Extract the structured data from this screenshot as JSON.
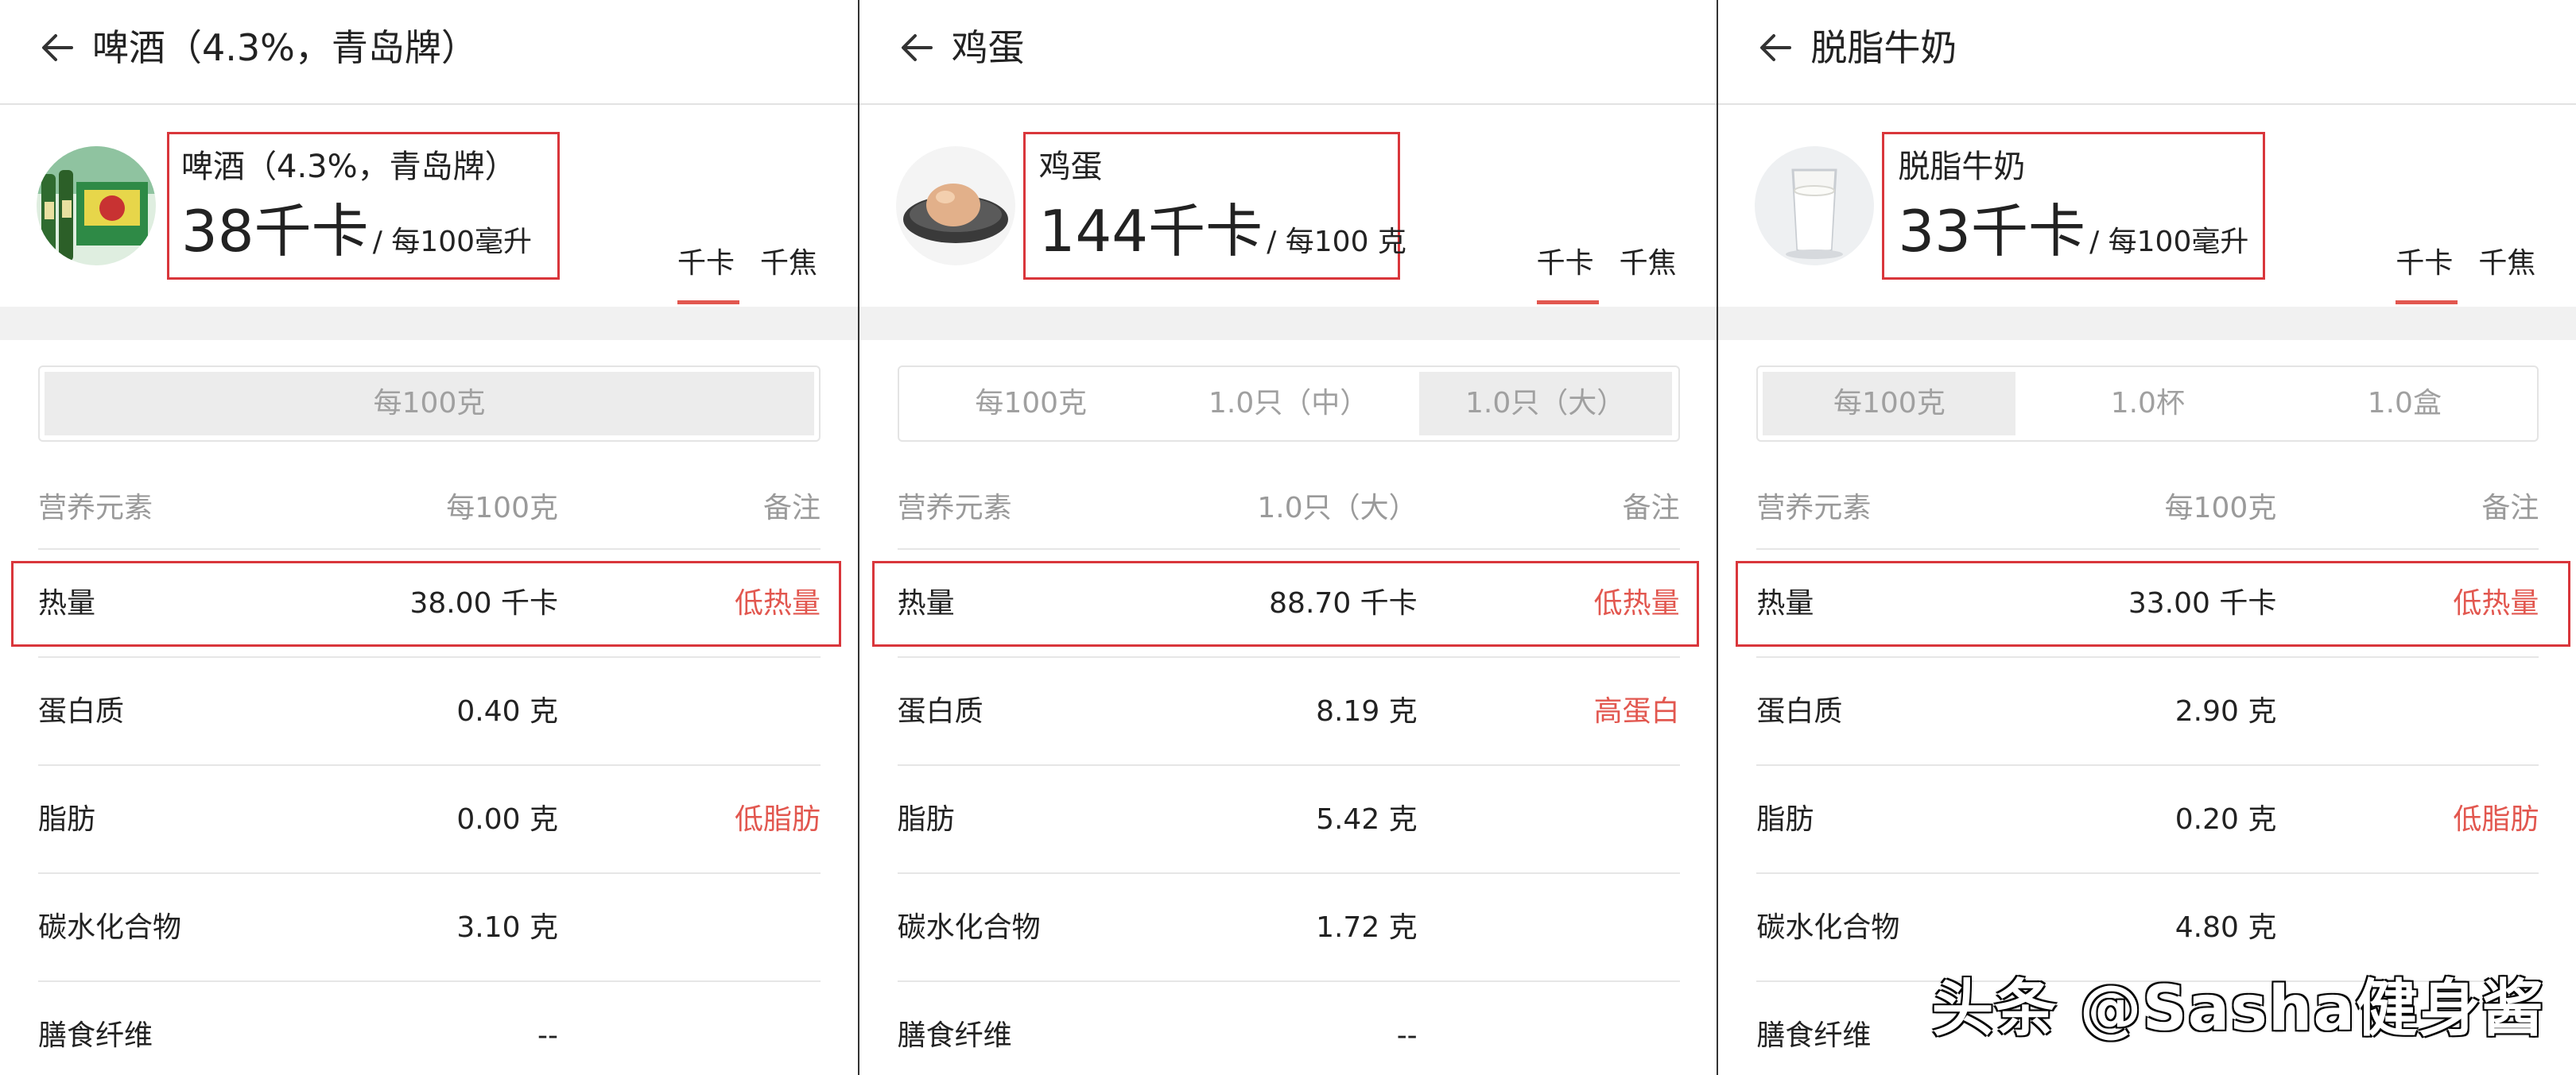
{
  "panels": [
    {
      "topbar_title": "啤酒（4.3%，青岛牌）",
      "food_name": "啤酒（4.3%，青岛牌）",
      "calories": "38千卡",
      "per_unit": "/ 每100毫升",
      "unit_tabs": [
        "千卡",
        "千焦"
      ],
      "servings": [
        "每100克"
      ],
      "selected_serving": 0,
      "table_header": {
        "name": "营养元素",
        "value": "每100克",
        "note": "备注"
      },
      "rows": [
        {
          "name": "热量",
          "value": "38.00 千卡",
          "note": "低热量"
        },
        {
          "name": "蛋白质",
          "value": "0.40 克",
          "note": ""
        },
        {
          "name": "脂肪",
          "value": "0.00 克",
          "note": "低脂肪"
        },
        {
          "name": "碳水化合物",
          "value": "3.10 克",
          "note": ""
        },
        {
          "name": "膳食纤维",
          "value": "--",
          "note": ""
        }
      ]
    },
    {
      "topbar_title": "鸡蛋",
      "food_name": "鸡蛋",
      "calories": "144千卡",
      "per_unit": "/ 每100 克",
      "unit_tabs": [
        "千卡",
        "千焦"
      ],
      "servings": [
        "每100克",
        "1.0只（中）",
        "1.0只（大）"
      ],
      "selected_serving": 2,
      "table_header": {
        "name": "营养元素",
        "value": "1.0只（大）",
        "note": "备注"
      },
      "rows": [
        {
          "name": "热量",
          "value": "88.70 千卡",
          "note": "低热量"
        },
        {
          "name": "蛋白质",
          "value": "8.19 克",
          "note": "高蛋白"
        },
        {
          "name": "脂肪",
          "value": "5.42 克",
          "note": ""
        },
        {
          "name": "碳水化合物",
          "value": "1.72 克",
          "note": ""
        },
        {
          "name": "膳食纤维",
          "value": "--",
          "note": ""
        }
      ]
    },
    {
      "topbar_title": "脱脂牛奶",
      "food_name": "脱脂牛奶",
      "calories": "33千卡",
      "per_unit": "/ 每100毫升",
      "unit_tabs": [
        "千卡",
        "千焦"
      ],
      "servings": [
        "每100克",
        "1.0杯",
        "1.0盒"
      ],
      "selected_serving": 0,
      "table_header": {
        "name": "营养元素",
        "value": "每100克",
        "note": "备注"
      },
      "rows": [
        {
          "name": "热量",
          "value": "33.00 千卡",
          "note": "低热量"
        },
        {
          "name": "蛋白质",
          "value": "2.90 克",
          "note": ""
        },
        {
          "name": "脂肪",
          "value": "0.20 克",
          "note": "低脂肪"
        },
        {
          "name": "碳水化合物",
          "value": "4.80 克",
          "note": ""
        },
        {
          "name": "膳食纤维",
          "value": "",
          "note": ""
        }
      ]
    }
  ],
  "watermark": "头条 @Sasha健身酱",
  "icons": {
    "back": "back-arrow-icon"
  },
  "colors": {
    "accent_red": "#e2574f",
    "highlight_box": "#d9363b"
  }
}
